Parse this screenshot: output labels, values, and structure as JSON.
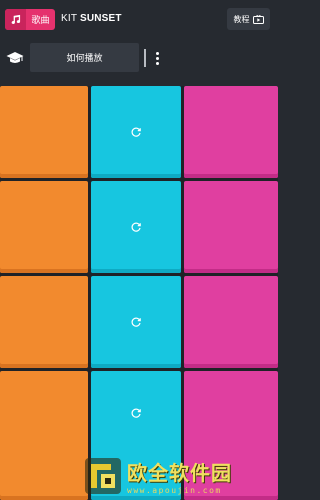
{
  "header": {
    "songs_label": "歌曲",
    "kit_prefix": "KIT",
    "kit_name": "SUNSET",
    "tutorial_label": "教程"
  },
  "toolbar": {
    "howto_label": "如何播放"
  },
  "pads": {
    "rows": 4,
    "columns": [
      "orange",
      "blue",
      "pink"
    ],
    "colors": {
      "orange": "#f28a2e",
      "blue": "#17c6e0",
      "pink": "#e03fa0"
    },
    "loop_icon_column": "blue"
  },
  "watermark": {
    "title": "欧全软件园",
    "url": "www.apoujin.com"
  }
}
